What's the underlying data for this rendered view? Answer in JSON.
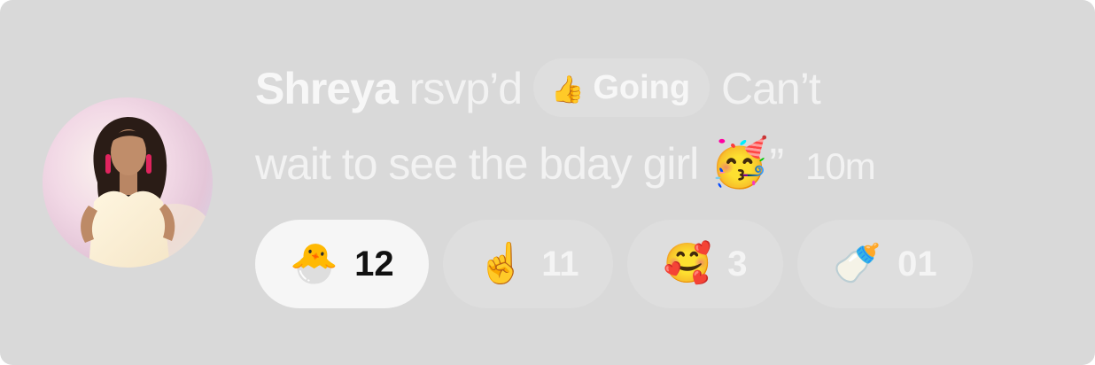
{
  "colors": {
    "card_bg": "#d9d9d9",
    "text": "#f2f2f2",
    "chip_bg": "#dedede",
    "chip_active_bg": "#f6f6f6",
    "active_count": "#111111"
  },
  "activity": {
    "user_name": "Shreya",
    "action": "rsvp’d",
    "status_badge": {
      "icon": "thumbs-up-icon",
      "glyph": "👍",
      "label": "Going"
    },
    "comment_line1": "Can’t",
    "comment_line2": "wait to see the bday girl",
    "comment_emoji": "🥳",
    "comment_close": "”",
    "time_ago": "10m"
  },
  "reactions": [
    {
      "name": "hatching-chick",
      "glyph": "🐣",
      "count": "12",
      "active": true
    },
    {
      "name": "index-pointing-up",
      "glyph": "☝️",
      "count": "11",
      "active": false
    },
    {
      "name": "smiling-face-with-hearts",
      "glyph": "🥰",
      "count": "3",
      "active": false
    },
    {
      "name": "baby-bottle",
      "glyph": "🍼",
      "count": "01",
      "active": false
    }
  ]
}
